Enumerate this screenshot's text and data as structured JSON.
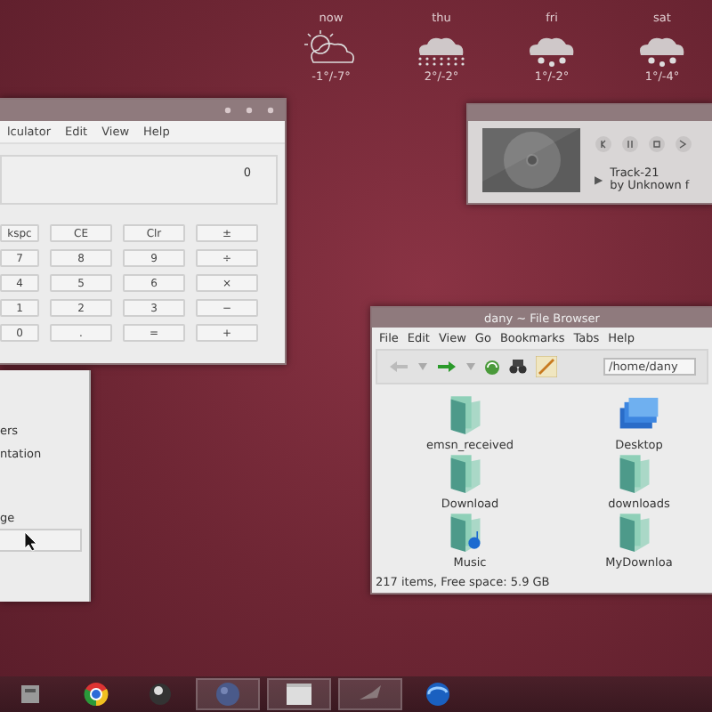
{
  "weather": [
    {
      "day": "now",
      "kind": "sun_cloud",
      "temp": "-1°/-7°"
    },
    {
      "day": "thu",
      "kind": "snow_heavy",
      "temp": "2°/-2°"
    },
    {
      "day": "fri",
      "kind": "snow_light",
      "temp": "1°/-2°"
    },
    {
      "day": "sat",
      "kind": "snow_light",
      "temp": "1°/-4°"
    }
  ],
  "calculator": {
    "menu": [
      "lculator",
      "Edit",
      "View",
      "Help"
    ],
    "display": "0",
    "keys": [
      [
        "kspc",
        "CE",
        "Clr",
        "±"
      ],
      [
        "7",
        "8",
        "9",
        "÷"
      ],
      [
        "4",
        "5",
        "6",
        "×"
      ],
      [
        "1",
        "2",
        "3",
        "−"
      ],
      [
        "0",
        ".",
        "=",
        "+"
      ]
    ]
  },
  "player": {
    "play": "▶",
    "title": "Track-21",
    "artist": "by Unknown f"
  },
  "file_browser": {
    "title": "dany ~ File Browser",
    "menu": [
      "File",
      "Edit",
      "View",
      "Go",
      "Bookmarks",
      "Tabs",
      "Help"
    ],
    "path": "/home/dany",
    "items": [
      {
        "name": "emsn_received",
        "kind": "folder"
      },
      {
        "name": "Desktop",
        "kind": "desktop"
      },
      {
        "name": "Download",
        "kind": "folder"
      },
      {
        "name": "downloads",
        "kind": "folder"
      },
      {
        "name": "Music",
        "kind": "music"
      },
      {
        "name": "MyDownloa",
        "kind": "folder"
      }
    ],
    "status": "217 items, Free space: 5.9 GB"
  },
  "dialog": {
    "lines": [
      "ers",
      "ntation",
      "ge"
    ]
  },
  "taskbar": [
    {
      "kind": "grid"
    },
    {
      "kind": "ring"
    },
    {
      "kind": "dark_ball"
    },
    {
      "kind": "globe_task"
    },
    {
      "kind": "window_task"
    },
    {
      "kind": "bird_task"
    },
    {
      "kind": "swirl"
    }
  ]
}
